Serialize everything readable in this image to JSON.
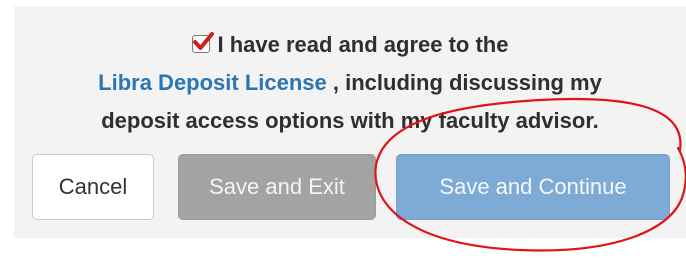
{
  "agreement": {
    "checked": true,
    "line1": "I have read and agree to the",
    "link_text": "Libra Deposit License",
    "line2_rest": " , including discussing my",
    "line3": "deposit access options with my faculty advisor."
  },
  "buttons": {
    "cancel_label": "Cancel",
    "save_exit_label": "Save and Exit",
    "save_continue_label": "Save and Continue"
  },
  "colors": {
    "link": "#2a76b5",
    "checkmark": "#d21f1f",
    "save_exit_bg": "#a3a3a3",
    "save_continue_bg": "#7eaad6",
    "annotation_circle": "#e0121a"
  },
  "icons": {
    "checkbox": "checkbox-checked-icon"
  }
}
